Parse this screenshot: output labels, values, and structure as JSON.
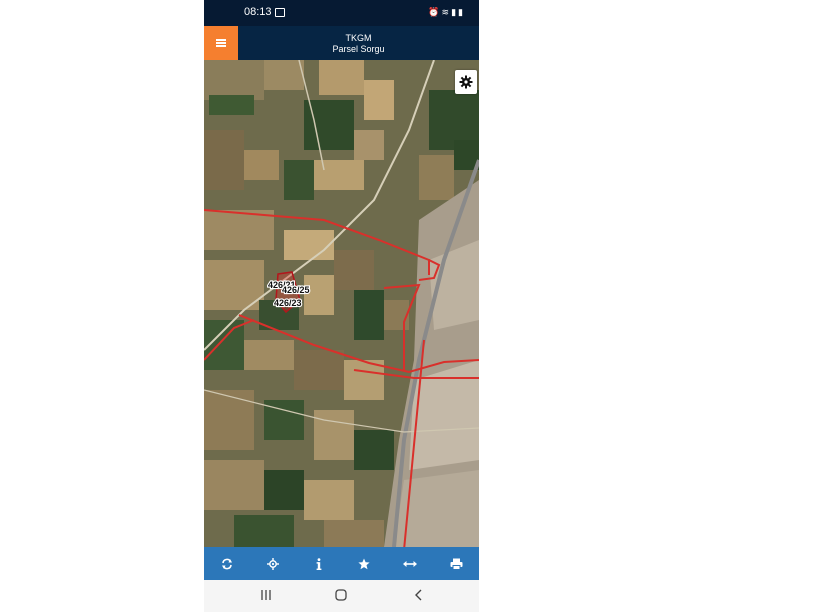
{
  "status_bar": {
    "time": "08:13",
    "icons": [
      "gallery-icon",
      "alarm-icon",
      "wifi-icon",
      "signal-icon",
      "battery-icon"
    ]
  },
  "header": {
    "title": "TKGM",
    "subtitle": "Parsel Sorgu",
    "menu_icon": "hamburger-menu-icon",
    "colors": {
      "header_bg": "#062544",
      "menu_bg": "#f57f2f"
    }
  },
  "map": {
    "type": "satellite",
    "parcel_labels": [
      "426/21",
      "426/25",
      "426/23"
    ],
    "settings_icon": "gear-icon",
    "boundary_color": "#d9302b"
  },
  "toolbar": {
    "color": "#2c77b9",
    "buttons": [
      {
        "icon": "refresh-icon"
      },
      {
        "icon": "locate-crosshair-icon"
      },
      {
        "icon": "info-icon"
      },
      {
        "icon": "star-icon"
      },
      {
        "icon": "measure-distance-icon"
      },
      {
        "icon": "print-icon"
      }
    ]
  },
  "nav_bar": {
    "buttons": [
      "recent-apps-icon",
      "home-icon",
      "back-icon"
    ]
  }
}
